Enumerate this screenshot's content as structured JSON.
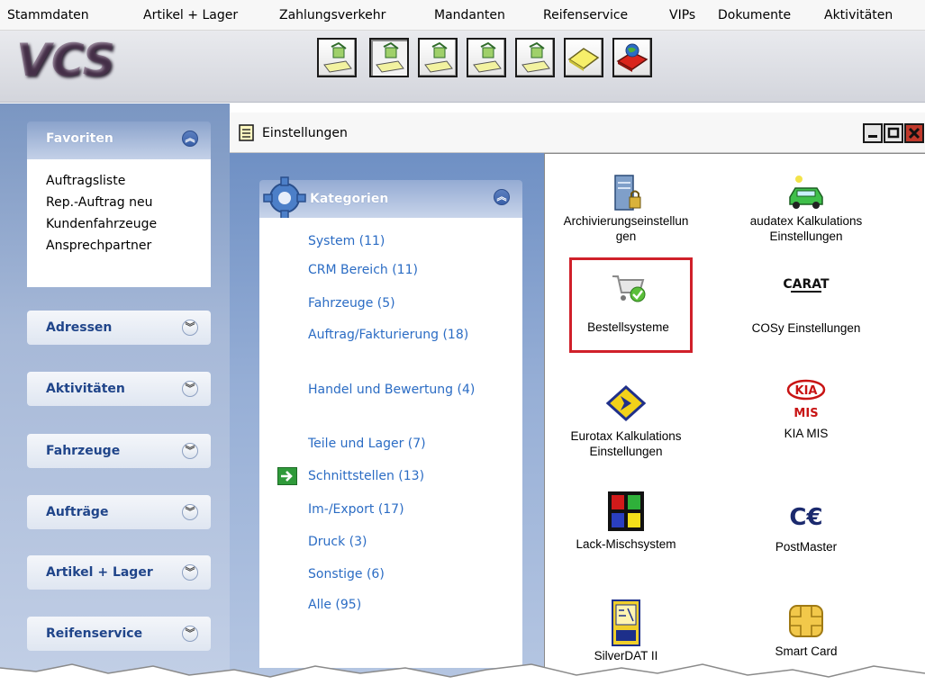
{
  "menu": [
    "Stammdaten",
    "Artikel + Lager",
    "Zahlungsverkehr",
    "Mandanten",
    "Reifenservice",
    "VIPs",
    "Dokumente",
    "Aktivitäten"
  ],
  "logo_text": "VCS",
  "sidebar": {
    "favorites": {
      "title": "Favoriten",
      "links": [
        "Auftragsliste",
        "Rep.-Auftrag neu",
        "Kundenfahrzeuge",
        "Ansprechpartner"
      ]
    },
    "sections": [
      "Adressen",
      "Aktivitäten",
      "Fahrzeuge",
      "Aufträge",
      "Artikel + Lager",
      "Reifenservice"
    ]
  },
  "window": {
    "title": "Einstellungen",
    "categories_title": "Kategorien",
    "categories": [
      "System (11)",
      "CRM Bereich (11)",
      "Fahrzeuge (5)",
      "Auftrag/Fakturierung (18)",
      "Handel und Bewertung (4)",
      "Teile und Lager (7)",
      "Schnittstellen (13)",
      "Im-/Export (17)",
      "Druck (3)",
      "Sonstige (6)",
      "Alle (95)"
    ],
    "selected_category": "Schnittstellen (13)",
    "items": [
      {
        "label": "Archivierungseinstellungen",
        "label_lines": [
          "Archivierungseinstellun",
          "gen"
        ],
        "icon": "server-lock-icon"
      },
      {
        "label": "audatex Kalkulations Einstellungen",
        "label_lines": [
          "audatex Kalkulations",
          "Einstellungen"
        ],
        "icon": "car-icon"
      },
      {
        "label": "Bestellsysteme",
        "label_lines": [
          "Bestellsysteme"
        ],
        "icon": "shopping-cart-icon",
        "highlighted": true
      },
      {
        "label": "COSy Einstellungen",
        "label_lines": [
          "COSy Einstellungen"
        ],
        "icon": "carat-logo-icon",
        "logo_text": "CARAT"
      },
      {
        "label": "Eurotax Kalkulations Einstellungen",
        "label_lines": [
          "Eurotax Kalkulations",
          "Einstellungen"
        ],
        "icon": "eurotax-logo-icon"
      },
      {
        "label": "KIA MIS",
        "label_lines": [
          "KIA MIS"
        ],
        "icon": "kia-logo-icon",
        "logo_text": "KIA",
        "logo_sub": "MIS"
      },
      {
        "label": "Lack-Mischsystem",
        "label_lines": [
          "Lack-Mischsystem"
        ],
        "icon": "color-grid-icon"
      },
      {
        "label": "PostMaster",
        "label_lines": [
          "PostMaster"
        ],
        "icon": "postmaster-logo-icon",
        "logo_text": "C€"
      },
      {
        "label": "SilverDAT II",
        "label_lines": [
          "SilverDAT II"
        ],
        "icon": "silverdat-icon"
      },
      {
        "label": "Smart Card",
        "label_lines": [
          "Smart Card"
        ],
        "icon": "chip-card-icon"
      }
    ]
  },
  "colors": {
    "link_blue": "#2b6cc4",
    "highlight_red": "#d0202a",
    "sidebar_title": "#20458a"
  }
}
